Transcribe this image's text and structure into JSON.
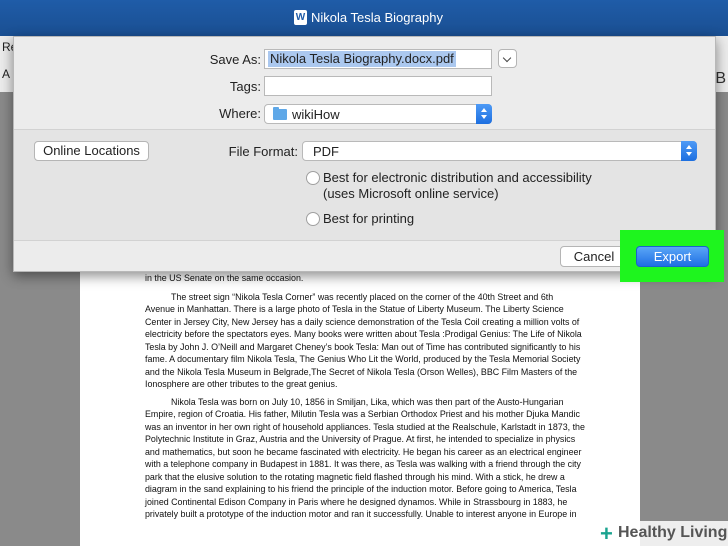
{
  "window": {
    "title": "Nikola Tesla Biography",
    "app_icon": "word-icon"
  },
  "ribbon": {
    "tab_1": "Re",
    "tab_2": "A",
    "right_1": "B",
    "right_2": "tle"
  },
  "dialog": {
    "save_as_label": "Save As:",
    "save_as_value": "Nikola Tesla Biography.docx.pdf",
    "tags_label": "Tags:",
    "tags_value": "",
    "where_label": "Where:",
    "where_value": "wikiHow",
    "online_locations_label": "Online Locations",
    "file_format_label": "File Format:",
    "file_format_value": "PDF",
    "option_1_line1": "Best for electronic distribution and accessibility",
    "option_1_line2": "(uses Microsoft online service)",
    "option_2": "Best for printing",
    "cancel_label": "Cancel",
    "export_label": "Export",
    "export_highlight_color": "#1ef51e"
  },
  "document": {
    "line_0": "in the US Senate on the same occasion.",
    "para_1": "The street sign “Nikola Tesla Corner” was recently placed on the corner of the 40th Street and 6th Avenue in Manhattan. There is a large photo of Tesla in the Statue of Liberty Museum. The Liberty Science Center in Jersey City, New Jersey has a daily science demonstration of the Tesla Coil creating a million volts of electricity before the spectators eyes. Many books were written about Tesla :Prodigal Genius: The Life of Nikola Tesla by John J. O’Neill  and Margaret Cheney’s book Tesla: Man out of Time has contributed significantly to his fame. A documentary film Nikola Tesla, The Genius Who Lit the World, produced by the Tesla Memorial Society and the Nikola Tesla Museum in Belgrade,The Secret of Nikola Tesla (Orson Welles), BBC Film Masters of the Ionosphere are other tributes to the great genius.",
    "para_2": "Nikola Tesla was born on July 10, 1856 in Smiljan, Lika, which was then part of  the Austo-Hungarian Empire, region of Croatia. His father, Milutin Tesla was a Serbian Orthodox Priest and his mother Djuka Mandic was an inventor in her own right of household appliances. Tesla studied at the Realschule, Karlstadt in 1873, the Polytechnic Institute in Graz, Austria and the University of Prague. At first, he intended to specialize in physics and mathematics, but soon he became fascinated with electricity. He began his career as an electrical engineer with a telephone company in Budapest in 1881. It was there, as Tesla was walking with a friend through the city park that the elusive solution to the rotating magnetic field flashed through his mind. With a stick, he drew a diagram in the sand explaining to his friend the principle of the induction motor. Before going to America, Tesla joined Continental Edison Company in Paris where he designed dynamos. While in Strassbourg in 1883, he privately built a prototype of the induction motor and ran it successfully. Unable to interest anyone in Europe in"
  },
  "watermark": {
    "text": "Healthy Living",
    "color": "#1aa38f"
  }
}
